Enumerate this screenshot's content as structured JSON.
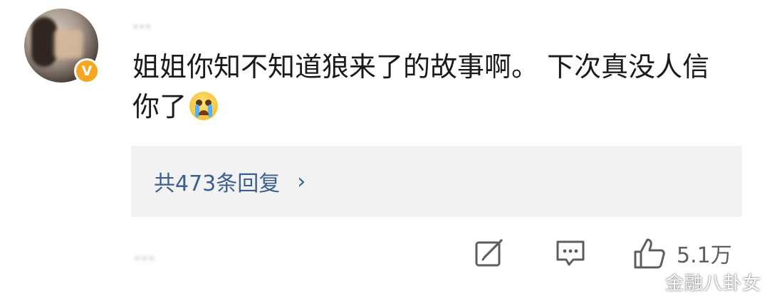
{
  "comment": {
    "author_name": "…",
    "verified_badge": "V",
    "text": "姐姐你知不知道狼来了的故事啊。 下次真没人信你了",
    "emoji": "crying-face-icon"
  },
  "replies": {
    "link_text": "共473条回复",
    "chevron": "›"
  },
  "meta": {
    "obscured_info": "…"
  },
  "actions": {
    "like_count": "5.1万"
  },
  "watermark": "金融八卦女",
  "colors": {
    "link": "#3b5f8f",
    "verified": "#f5a623",
    "reply_box_bg": "#f2f2f2",
    "text": "#1a1a1a",
    "muted": "#8a8a8a"
  }
}
